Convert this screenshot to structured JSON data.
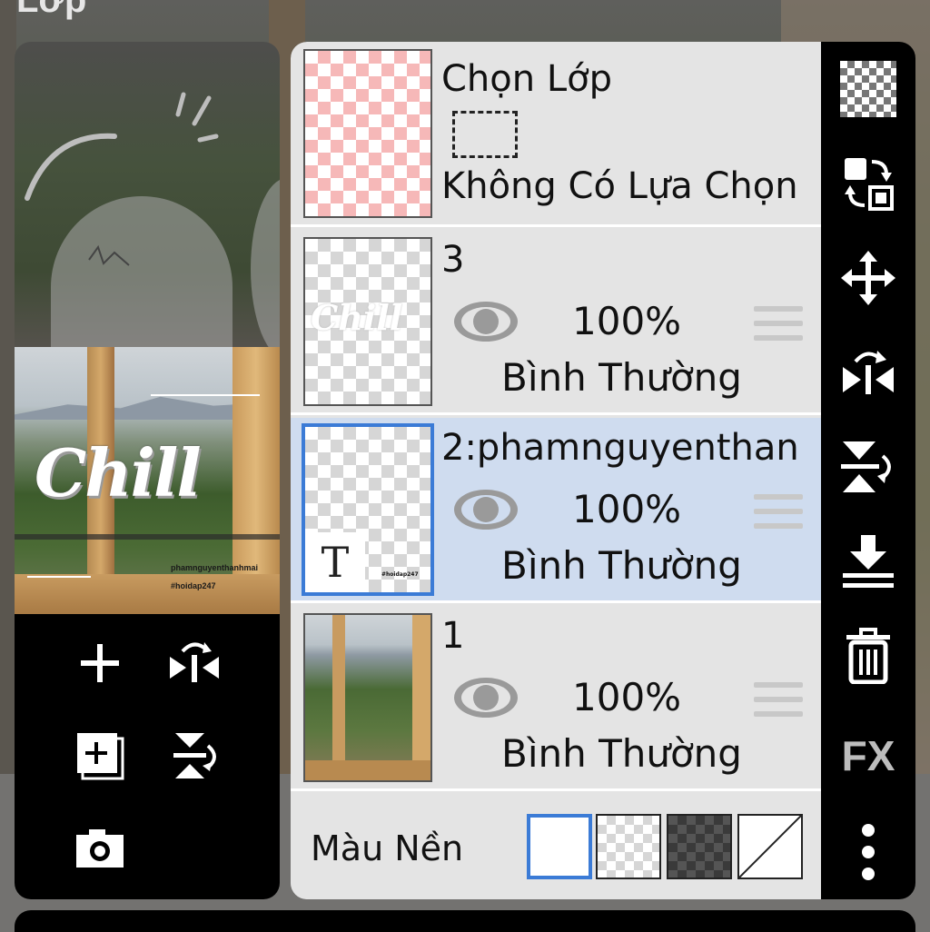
{
  "window": {
    "title": "Lớp"
  },
  "canvas_preview": {
    "artwork_text": "Chill",
    "watermark_name": "phamnguyenthanhmai",
    "watermark_hashtag": "#hoidap247"
  },
  "left_tools": {
    "add_layer": "add-layer",
    "flip_horizontal": "flip-horizontal",
    "add_layer_copy": "add-layer-copy",
    "flip_vertical": "flip-vertical",
    "camera": "camera"
  },
  "selection_layer": {
    "title": "Chọn Lớp",
    "subtitle": "Không Có Lựa Chọn"
  },
  "layers": [
    {
      "name": "3",
      "opacity": "100%",
      "blend": "Bình Thường",
      "selected": false
    },
    {
      "name": "2:phamnguyenthan",
      "opacity": "100%",
      "blend": "Bình Thường",
      "selected": true,
      "thumb_badge": "T",
      "thumb_small_text": "#hoidap247"
    },
    {
      "name": "1",
      "opacity": "100%",
      "blend": "Bình Thường",
      "selected": false
    }
  ],
  "background_color": {
    "label": "Màu Nền",
    "options": [
      "white",
      "light-checker",
      "dark-checker",
      "none"
    ],
    "selected": "white"
  },
  "side_toolbar": {
    "icons": [
      "transparency-icon",
      "swap-layers-icon",
      "move-icon",
      "flip-horizontal-icon",
      "flip-vertical-icon",
      "merge-down-icon",
      "trash-icon",
      "fx",
      "more-icon"
    ],
    "fx_label": "FX"
  },
  "colors": {
    "accent": "#3b7bd6",
    "selected_row": "#cfdcef",
    "panel_bg": "#e4e4e4",
    "toolbar_bg": "#000000"
  }
}
